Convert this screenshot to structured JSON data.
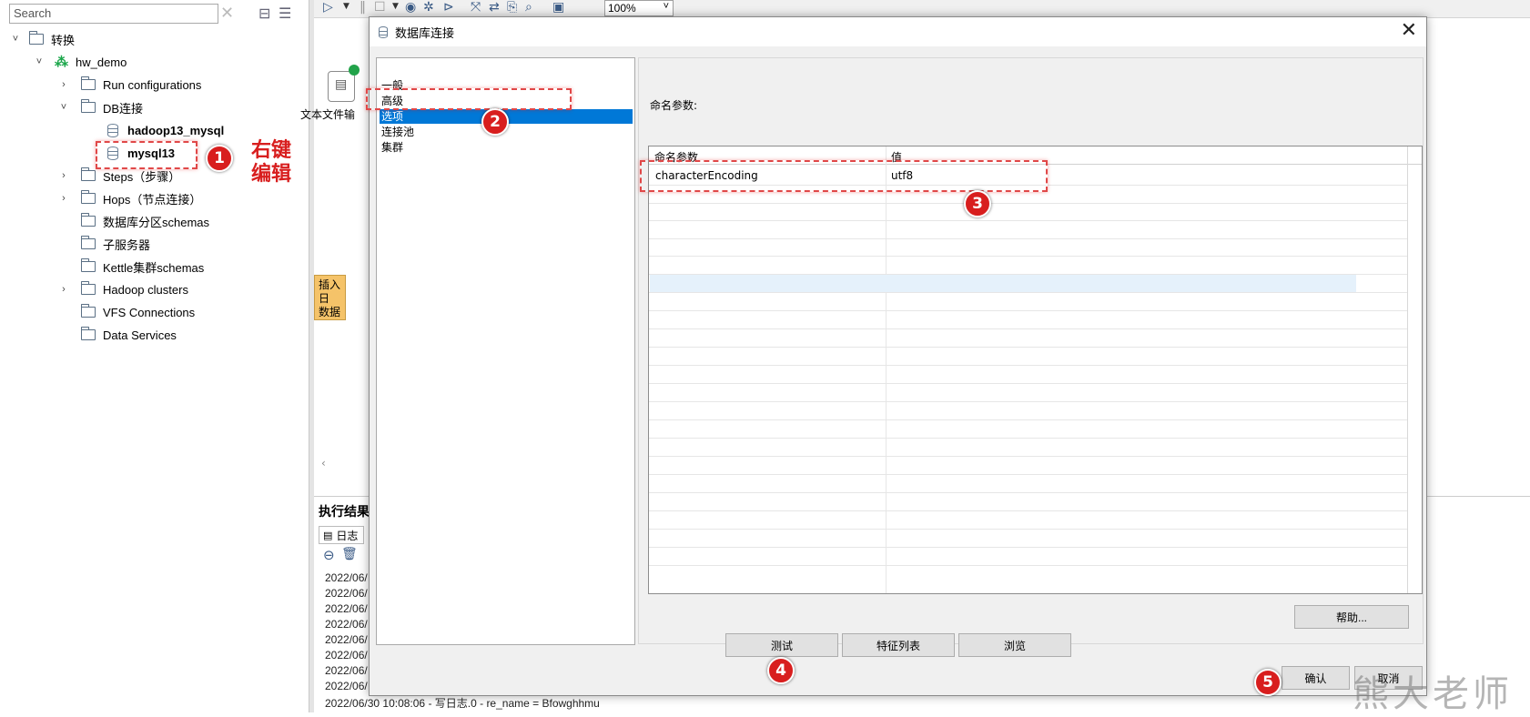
{
  "left_panel": {
    "search_placeholder": "Search",
    "tree": [
      {
        "label": "转换",
        "level": 0,
        "expanded": true
      },
      {
        "label": "hw_demo",
        "level": 1,
        "expanded": true
      },
      {
        "label": "Run configurations",
        "level": 2,
        "expanded": false
      },
      {
        "label": "DB连接",
        "level": 2,
        "expanded": true
      },
      {
        "label": "hadoop13_mysql",
        "level": 3
      },
      {
        "label": "mysql13",
        "level": 3
      },
      {
        "label": "Steps（步骤）",
        "level": 2,
        "expanded": false
      },
      {
        "label": "Hops（节点连接）",
        "level": 2,
        "expanded": false
      },
      {
        "label": "数据库分区schemas",
        "level": 2
      },
      {
        "label": "子服务器",
        "level": 2
      },
      {
        "label": "Kettle集群schemas",
        "level": 2
      },
      {
        "label": "Hadoop clusters",
        "level": 2,
        "expanded": false
      },
      {
        "label": "VFS Connections",
        "level": 2
      },
      {
        "label": "Data Services",
        "level": 2
      }
    ]
  },
  "toolbar": {
    "zoom": "100%"
  },
  "canvas": {
    "step_label": "文本文件输",
    "note_line1": "插入日",
    "note_line2": "数据处"
  },
  "results": {
    "title": "执行结果",
    "tab_log": "日志",
    "log_lines": [
      "2022/06/",
      "2022/06/",
      "2022/06/",
      "2022/06/",
      "2022/06/",
      "2022/06/",
      "2022/06/",
      "2022/06/",
      "2022/06/30 10:08:06 - 写日志.0 - re_name = Bfowghhmu",
      "2022/06/30 10:08:06 - 写日志.0 - ..."
    ]
  },
  "dialog": {
    "title": "数据库连接",
    "categories": [
      "一般",
      "高级",
      "选项",
      "连接池",
      "集群"
    ],
    "selected_category": "选项",
    "named_params_label": "命名参数:",
    "grid_headers": [
      "命名参数",
      "值"
    ],
    "grid_rows": [
      {
        "name": "characterEncoding",
        "value": "utf8"
      }
    ],
    "help_button": "帮助...",
    "test_button": "测试",
    "features_button": "特征列表",
    "browse_button": "浏览",
    "ok_button": "确认",
    "cancel_button": "取消"
  },
  "annotations": {
    "markers": [
      "1",
      "2",
      "3",
      "4",
      "5"
    ],
    "right_click_edit_line1": "右键",
    "right_click_edit_line2": "编辑"
  },
  "watermark": "熊大老师",
  "colors": {
    "selection": "#0078d7",
    "highlight_red": "#d81e1e",
    "note_yellow": "#f5c369",
    "grid_selected_row": "#e5f1fb"
  }
}
